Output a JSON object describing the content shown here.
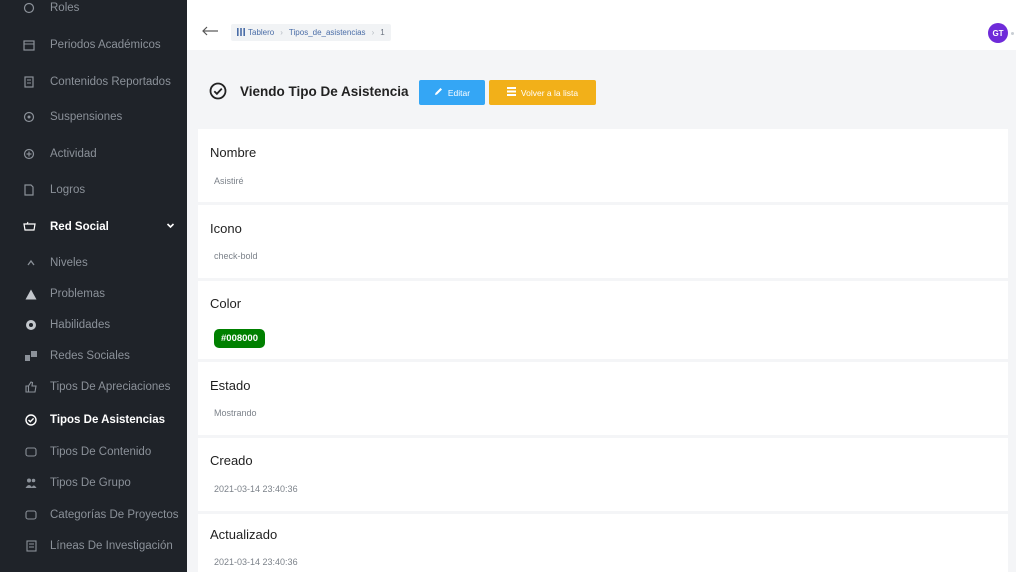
{
  "sidebar": {
    "items": [
      {
        "label": "Roles",
        "icon": "roles-icon"
      },
      {
        "label": "Periodos Académicos",
        "icon": "calendar-icon"
      },
      {
        "label": "Contenidos Reportados",
        "icon": "report-icon"
      },
      {
        "label": "Suspensiones",
        "icon": "suspension-icon"
      },
      {
        "label": "Actividad",
        "icon": "activity-icon"
      },
      {
        "label": "Logros",
        "icon": "achievement-icon"
      },
      {
        "label": "Red Social",
        "icon": "social-network-icon"
      },
      {
        "label": "Niveles",
        "icon": "levels-icon"
      },
      {
        "label": "Problemas",
        "icon": "warning-icon"
      },
      {
        "label": "Habilidades",
        "icon": "skills-icon"
      },
      {
        "label": "Redes Sociales",
        "icon": "social-icon"
      },
      {
        "label": "Tipos De Apreciaciones",
        "icon": "thumbs-up-icon"
      },
      {
        "label": "Tipos De Asistencias",
        "icon": "check-circle-icon"
      },
      {
        "label": "Tipos De Contenido",
        "icon": "content-icon"
      },
      {
        "label": "Tipos De Grupo",
        "icon": "group-icon"
      },
      {
        "label": "Categorías De Proyectos",
        "icon": "category-icon"
      },
      {
        "label": "Líneas De Investigación",
        "icon": "document-icon"
      }
    ]
  },
  "breadcrumb": {
    "home": "Tablero",
    "section": "Tipos_de_asistencias",
    "current": "1"
  },
  "user": {
    "initials": "GT"
  },
  "header": {
    "title": "Viendo Tipo De Asistencia",
    "edit_label": "Editar",
    "back_label": "Volver a la lista"
  },
  "fields": [
    {
      "label": "Nombre",
      "value": "Asistiré"
    },
    {
      "label": "Icono",
      "value": "check-bold"
    },
    {
      "label": "Color",
      "value": "#008000"
    },
    {
      "label": "Estado",
      "value": "Mostrando"
    },
    {
      "label": "Creado",
      "value": "2021-03-14 23:40:36"
    },
    {
      "label": "Actualizado",
      "value": "2021-03-14 23:40:36"
    }
  ],
  "colors": {
    "sidebar_bg": "#1f2329",
    "edit_button": "#34a6f5",
    "back_button": "#f2b019",
    "badge": "#008000",
    "avatar": "#6f2bd9"
  }
}
